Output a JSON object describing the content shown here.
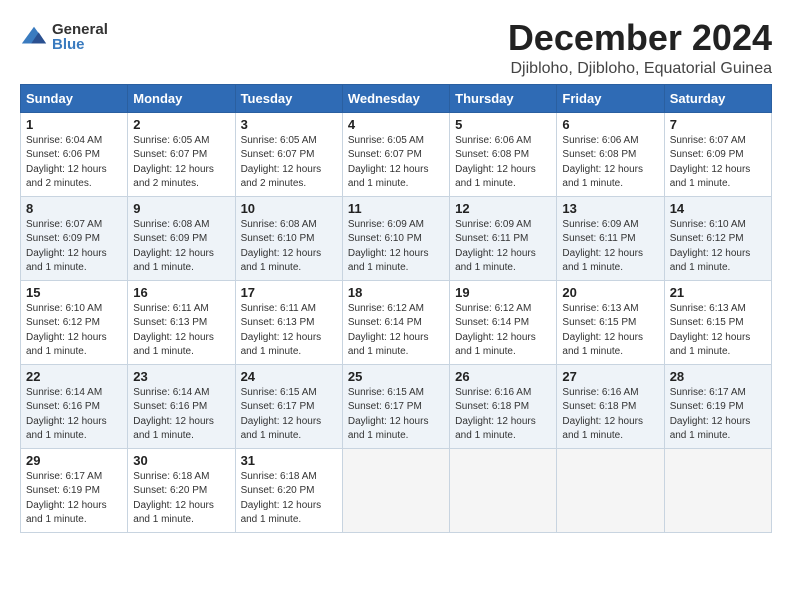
{
  "logo": {
    "general": "General",
    "blue": "Blue"
  },
  "title": "December 2024",
  "subtitle": "Djibloho, Djibloho, Equatorial Guinea",
  "days_of_week": [
    "Sunday",
    "Monday",
    "Tuesday",
    "Wednesday",
    "Thursday",
    "Friday",
    "Saturday"
  ],
  "weeks": [
    [
      {
        "day": "1",
        "sunrise": "6:04 AM",
        "sunset": "6:06 PM",
        "daylight": "12 hours and 2 minutes."
      },
      {
        "day": "2",
        "sunrise": "6:05 AM",
        "sunset": "6:07 PM",
        "daylight": "12 hours and 2 minutes."
      },
      {
        "day": "3",
        "sunrise": "6:05 AM",
        "sunset": "6:07 PM",
        "daylight": "12 hours and 2 minutes."
      },
      {
        "day": "4",
        "sunrise": "6:05 AM",
        "sunset": "6:07 PM",
        "daylight": "12 hours and 1 minute."
      },
      {
        "day": "5",
        "sunrise": "6:06 AM",
        "sunset": "6:08 PM",
        "daylight": "12 hours and 1 minute."
      },
      {
        "day": "6",
        "sunrise": "6:06 AM",
        "sunset": "6:08 PM",
        "daylight": "12 hours and 1 minute."
      },
      {
        "day": "7",
        "sunrise": "6:07 AM",
        "sunset": "6:09 PM",
        "daylight": "12 hours and 1 minute."
      }
    ],
    [
      {
        "day": "8",
        "sunrise": "6:07 AM",
        "sunset": "6:09 PM",
        "daylight": "12 hours and 1 minute."
      },
      {
        "day": "9",
        "sunrise": "6:08 AM",
        "sunset": "6:09 PM",
        "daylight": "12 hours and 1 minute."
      },
      {
        "day": "10",
        "sunrise": "6:08 AM",
        "sunset": "6:10 PM",
        "daylight": "12 hours and 1 minute."
      },
      {
        "day": "11",
        "sunrise": "6:09 AM",
        "sunset": "6:10 PM",
        "daylight": "12 hours and 1 minute."
      },
      {
        "day": "12",
        "sunrise": "6:09 AM",
        "sunset": "6:11 PM",
        "daylight": "12 hours and 1 minute."
      },
      {
        "day": "13",
        "sunrise": "6:09 AM",
        "sunset": "6:11 PM",
        "daylight": "12 hours and 1 minute."
      },
      {
        "day": "14",
        "sunrise": "6:10 AM",
        "sunset": "6:12 PM",
        "daylight": "12 hours and 1 minute."
      }
    ],
    [
      {
        "day": "15",
        "sunrise": "6:10 AM",
        "sunset": "6:12 PM",
        "daylight": "12 hours and 1 minute."
      },
      {
        "day": "16",
        "sunrise": "6:11 AM",
        "sunset": "6:13 PM",
        "daylight": "12 hours and 1 minute."
      },
      {
        "day": "17",
        "sunrise": "6:11 AM",
        "sunset": "6:13 PM",
        "daylight": "12 hours and 1 minute."
      },
      {
        "day": "18",
        "sunrise": "6:12 AM",
        "sunset": "6:14 PM",
        "daylight": "12 hours and 1 minute."
      },
      {
        "day": "19",
        "sunrise": "6:12 AM",
        "sunset": "6:14 PM",
        "daylight": "12 hours and 1 minute."
      },
      {
        "day": "20",
        "sunrise": "6:13 AM",
        "sunset": "6:15 PM",
        "daylight": "12 hours and 1 minute."
      },
      {
        "day": "21",
        "sunrise": "6:13 AM",
        "sunset": "6:15 PM",
        "daylight": "12 hours and 1 minute."
      }
    ],
    [
      {
        "day": "22",
        "sunrise": "6:14 AM",
        "sunset": "6:16 PM",
        "daylight": "12 hours and 1 minute."
      },
      {
        "day": "23",
        "sunrise": "6:14 AM",
        "sunset": "6:16 PM",
        "daylight": "12 hours and 1 minute."
      },
      {
        "day": "24",
        "sunrise": "6:15 AM",
        "sunset": "6:17 PM",
        "daylight": "12 hours and 1 minute."
      },
      {
        "day": "25",
        "sunrise": "6:15 AM",
        "sunset": "6:17 PM",
        "daylight": "12 hours and 1 minute."
      },
      {
        "day": "26",
        "sunrise": "6:16 AM",
        "sunset": "6:18 PM",
        "daylight": "12 hours and 1 minute."
      },
      {
        "day": "27",
        "sunrise": "6:16 AM",
        "sunset": "6:18 PM",
        "daylight": "12 hours and 1 minute."
      },
      {
        "day": "28",
        "sunrise": "6:17 AM",
        "sunset": "6:19 PM",
        "daylight": "12 hours and 1 minute."
      }
    ],
    [
      {
        "day": "29",
        "sunrise": "6:17 AM",
        "sunset": "6:19 PM",
        "daylight": "12 hours and 1 minute."
      },
      {
        "day": "30",
        "sunrise": "6:18 AM",
        "sunset": "6:20 PM",
        "daylight": "12 hours and 1 minute."
      },
      {
        "day": "31",
        "sunrise": "6:18 AM",
        "sunset": "6:20 PM",
        "daylight": "12 hours and 1 minute."
      },
      null,
      null,
      null,
      null
    ]
  ],
  "labels": {
    "sunrise": "Sunrise:",
    "sunset": "Sunset:",
    "daylight": "Daylight:"
  }
}
